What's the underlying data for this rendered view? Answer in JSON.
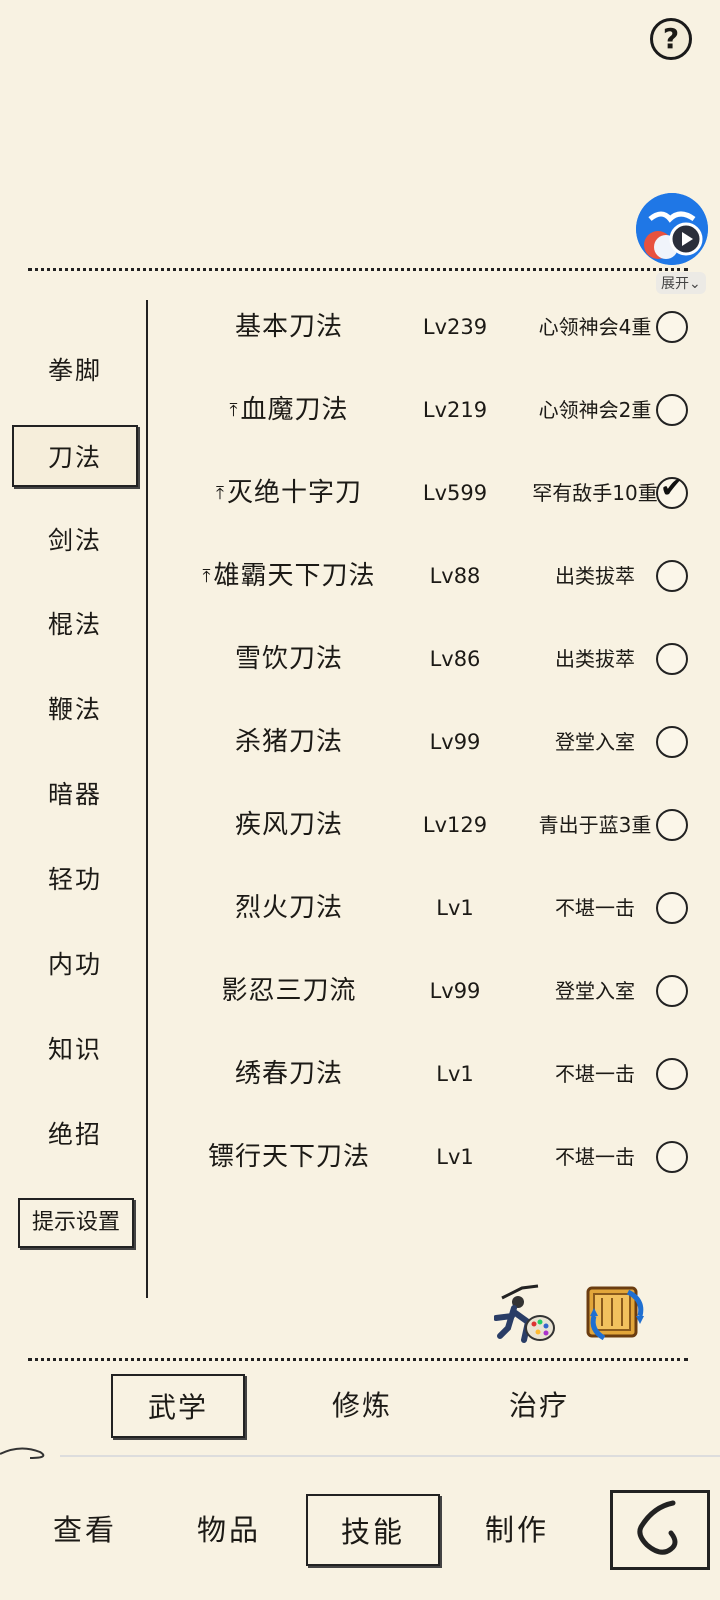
{
  "header": {
    "help_label": "?",
    "expand_label": "展开"
  },
  "sidebar": {
    "categories": [
      "拳脚",
      "刀法",
      "剑法",
      "棍法",
      "鞭法",
      "暗器",
      "轻功",
      "内功",
      "知识",
      "绝招"
    ],
    "selected_index": 1,
    "tip_settings_label": "提示设置"
  },
  "skills": [
    {
      "name": "基本刀法",
      "level": "Lv239",
      "rank": "心领神会4重",
      "pinned": false,
      "checked": false
    },
    {
      "name": "血魔刀法",
      "level": "Lv219",
      "rank": "心领神会2重",
      "pinned": true,
      "checked": false
    },
    {
      "name": "灭绝十字刀",
      "level": "Lv599",
      "rank": "罕有敌手10重",
      "pinned": true,
      "checked": true
    },
    {
      "name": "雄霸天下刀法",
      "level": "Lv88",
      "rank": "出类拔萃",
      "pinned": true,
      "checked": false
    },
    {
      "name": "雪饮刀法",
      "level": "Lv86",
      "rank": "出类拔萃",
      "pinned": false,
      "checked": false
    },
    {
      "name": "杀猪刀法",
      "level": "Lv99",
      "rank": "登堂入室",
      "pinned": false,
      "checked": false
    },
    {
      "name": "疾风刀法",
      "level": "Lv129",
      "rank": "青出于蓝3重",
      "pinned": false,
      "checked": false
    },
    {
      "name": "烈火刀法",
      "level": "Lv1",
      "rank": "不堪一击",
      "pinned": false,
      "checked": false
    },
    {
      "name": "影忍三刀流",
      "level": "Lv99",
      "rank": "登堂入室",
      "pinned": false,
      "checked": false
    },
    {
      "name": "绣春刀法",
      "level": "Lv1",
      "rank": "不堪一击",
      "pinned": false,
      "checked": false
    },
    {
      "name": "镖行天下刀法",
      "level": "Lv1",
      "rank": "不堪一击",
      "pinned": false,
      "checked": false
    }
  ],
  "subtabs": {
    "wuxue": "武学",
    "xiulian": "修炼",
    "zhiliao": "治疗"
  },
  "nav": {
    "view": "查看",
    "items": "物品",
    "skills": "技能",
    "craft": "制作"
  },
  "icons": {
    "help": "question-icon",
    "float": "video-assistant-icon",
    "pin": "pin-up-icon",
    "check": "check-icon",
    "appearance": "martial-artist-palette-icon",
    "swap": "scroll-swap-icon",
    "back": "back-icon"
  }
}
